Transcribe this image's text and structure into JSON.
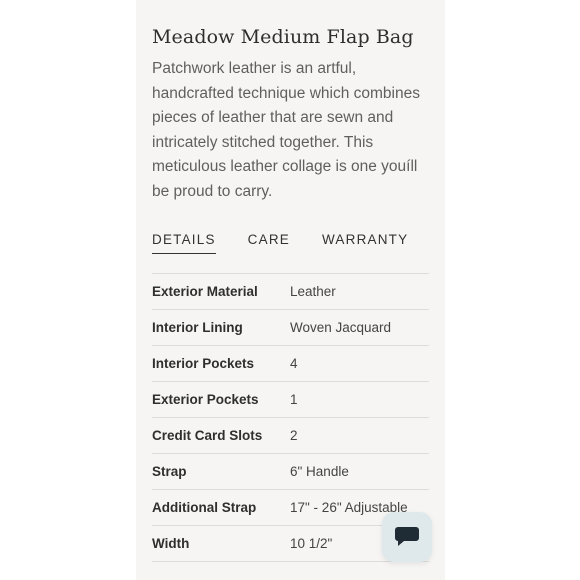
{
  "product": {
    "title": "Meadow Medium Flap Bag",
    "description": "Patchwork leather is an artful, handcrafted technique which combines pieces of leather that are sewn and intricately stitched together. This meticulous leather collage is one youíll be proud to carry."
  },
  "tabs": [
    {
      "label": "DETAILS",
      "active": true
    },
    {
      "label": "CARE",
      "active": false
    },
    {
      "label": "WARRANTY",
      "active": false
    }
  ],
  "details": [
    {
      "label": "Exterior Material",
      "value": "Leather"
    },
    {
      "label": "Interior Lining",
      "value": "Woven Jacquard"
    },
    {
      "label": "Interior Pockets",
      "value": "4"
    },
    {
      "label": "Exterior Pockets",
      "value": "1"
    },
    {
      "label": "Credit Card Slots",
      "value": "2"
    },
    {
      "label": "Strap",
      "value": "6\" Handle"
    },
    {
      "label": "Additional Strap",
      "value": "17\" - 26\" Adjustable"
    },
    {
      "label": "Width",
      "value": "10 1/2\""
    }
  ],
  "chat": {
    "icon": "chat-bubble-icon",
    "background": "#dfe8ea",
    "icon_color": "#1f2c36"
  },
  "colors": {
    "page_background": "#f6f5f3",
    "divider": "#dcdcdc",
    "text": "#2e2e2e"
  }
}
